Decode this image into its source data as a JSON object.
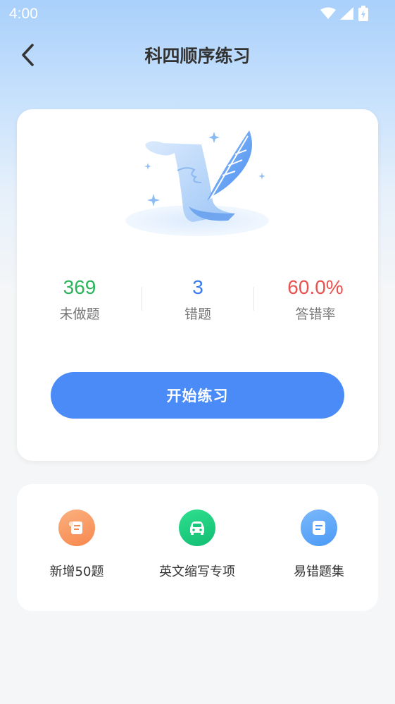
{
  "status_bar": {
    "time": "4:00"
  },
  "header": {
    "title": "科四顺序练习"
  },
  "stats": [
    {
      "value": "369",
      "label": "未做题",
      "color": "#2cb55b"
    },
    {
      "value": "3",
      "label": "错题",
      "color": "#3a7cf1"
    },
    {
      "value": "60.0%",
      "label": "答错率",
      "color": "#e9524f"
    }
  ],
  "start_button": {
    "label": "开始练习"
  },
  "actions": [
    {
      "label": "新增50题",
      "icon": "scroll-icon",
      "color": "#f7884f"
    },
    {
      "label": "英文缩写专项",
      "icon": "car-icon",
      "color": "#16c77b"
    },
    {
      "label": "易错题集",
      "icon": "document-icon",
      "color": "#4b9af6"
    }
  ],
  "colors": {
    "accent": "#4a8bf7"
  }
}
